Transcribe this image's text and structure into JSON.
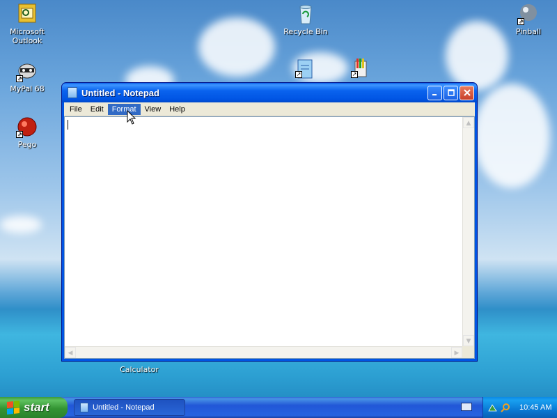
{
  "desktop": {
    "icons": [
      {
        "label": "Microsoft Outlook"
      },
      {
        "label": "Recycle Bin"
      },
      {
        "label": "Pinball"
      },
      {
        "label": "MyPal 68"
      },
      {
        "label": "Pego"
      },
      {
        "label": "Calculator"
      }
    ]
  },
  "window": {
    "title": "Untitled - Notepad",
    "menu": [
      "File",
      "Edit",
      "Format",
      "View",
      "Help"
    ],
    "active_menu": "Format",
    "editor_text": ""
  },
  "taskbar": {
    "start_label": "start",
    "task_button_label": "Untitled - Notepad",
    "clock": "10:45 AM"
  },
  "colors": {
    "titlebar": "#0054e3",
    "menu_highlight": "#316ac5",
    "start_green": "#339433"
  }
}
